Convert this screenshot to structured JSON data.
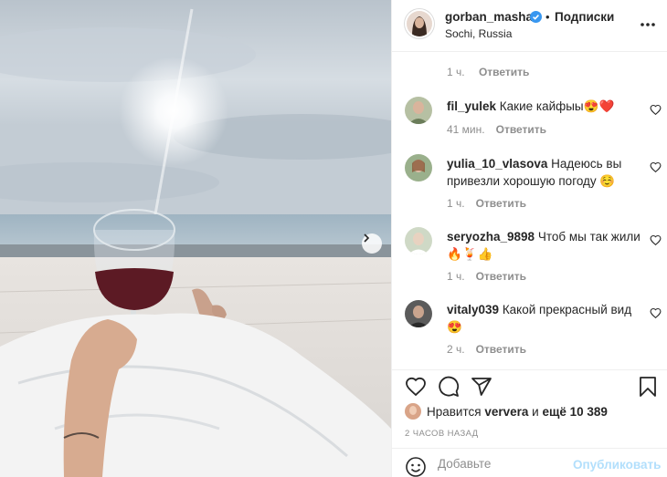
{
  "post": {
    "username": "gorban_masha",
    "separator": "•",
    "follow_label": "Подписки",
    "location": "Sochi, Russia",
    "verified": true
  },
  "comments": {
    "top_meta": {
      "time": "1 ч.",
      "reply": "Ответить"
    },
    "items": [
      {
        "user": "fil_yulek",
        "text": "Какие кайфыы😍❤️",
        "time": "41 мин.",
        "reply": "Ответить"
      },
      {
        "user": "yulia_10_vlasova",
        "text": "Надеюсь вы привезли хорошую погоду ☺️",
        "time": "1 ч.",
        "reply": "Ответить"
      },
      {
        "user": "seryozha_9898",
        "text": "Чтоб мы так жили🔥🍹👍",
        "time": "1 ч.",
        "reply": "Ответить"
      },
      {
        "user": "vitaly039",
        "text": "Какой прекрасный вид 😍",
        "time": "2 ч.",
        "reply": "Ответить"
      }
    ]
  },
  "likes": {
    "prefix": "Нравится",
    "user": "ververa",
    "middle": "и",
    "rest": "ещё 10 389"
  },
  "timestamp": "2 ЧАСОВ НАЗАД",
  "add_comment": {
    "placeholder": "Добавьте",
    "publish_label": "Опубликовать"
  },
  "colors": {
    "verified": "#3897f0",
    "heart": "#ed4956",
    "publish_disabled": "#b2dffc",
    "meta_gray": "#8e8e8e"
  },
  "icons": [
    "verified-badge-icon",
    "more-options-icon",
    "like-heart-icon",
    "comment-icon",
    "share-icon",
    "save-bookmark-icon",
    "emoji-icon",
    "next-arrow-icon"
  ]
}
